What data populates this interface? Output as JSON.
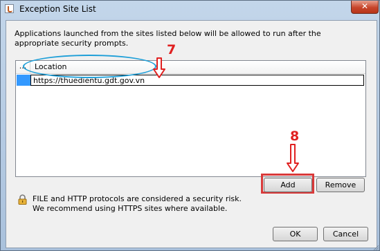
{
  "window": {
    "title": "Exception Site List",
    "close_label": "✕"
  },
  "description": "Applications launched from the sites listed below will be allowed to run after the appropriate security prompts.",
  "table": {
    "columns": [
      "...",
      "Location"
    ],
    "rows": [
      {
        "location": "https://thuedientu.gdt.gov.vn"
      }
    ]
  },
  "annotations": {
    "step_7": "7",
    "step_8": "8",
    "highlight_color": "#e02020",
    "ellipse_color": "#1e9fd8"
  },
  "buttons": {
    "add": "Add",
    "remove": "Remove",
    "ok": "OK",
    "cancel": "Cancel"
  },
  "warning": {
    "line1": "FILE and HTTP protocols are considered a security risk.",
    "line2": "We recommend using HTTPS sites where available.",
    "icon": "lock-icon"
  }
}
